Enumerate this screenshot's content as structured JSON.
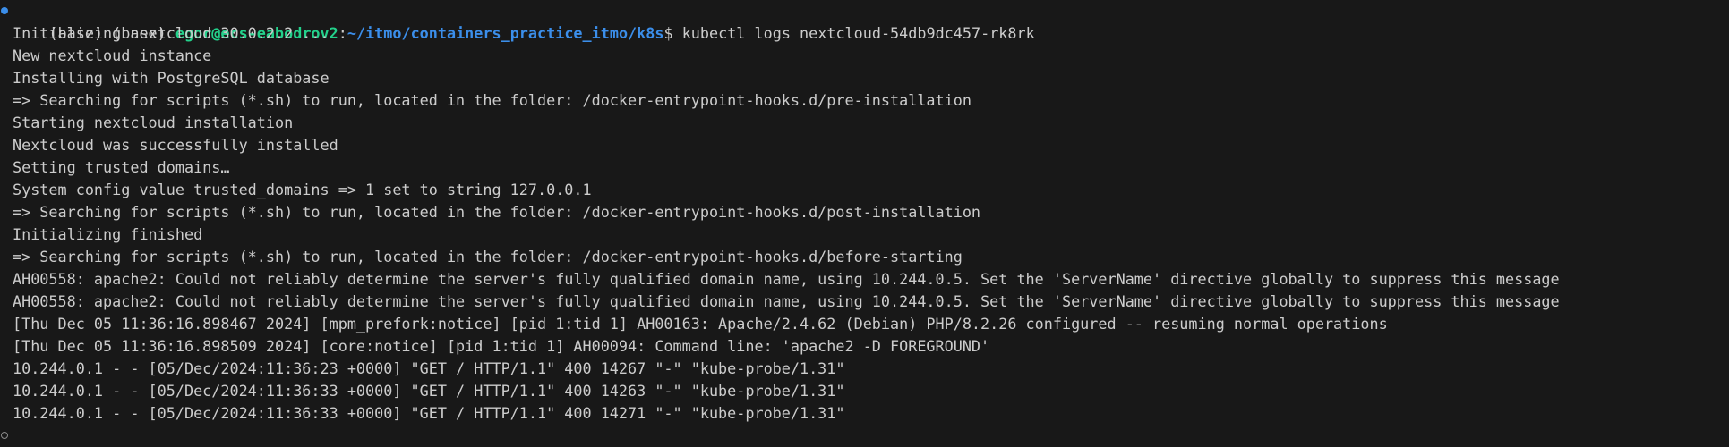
{
  "prompt": {
    "env": "(base) (base) ",
    "user_host": "egor@ecs-eabodrov2",
    "sep": ":",
    "path": "~/itmo/containers_practice_itmo/k8s",
    "symbol": "$ "
  },
  "command": "kubectl logs nextcloud-54db9dc457-rk8rk",
  "output_lines": [
    "Initializing nextcloud 30.0.2.2 ...",
    "New nextcloud instance",
    "Installing with PostgreSQL database",
    "=> Searching for scripts (*.sh) to run, located in the folder: /docker-entrypoint-hooks.d/pre-installation",
    "Starting nextcloud installation",
    "Nextcloud was successfully installed",
    "Setting trusted domains…",
    "System config value trusted_domains => 1 set to string 127.0.0.1",
    "=> Searching for scripts (*.sh) to run, located in the folder: /docker-entrypoint-hooks.d/post-installation",
    "Initializing finished",
    "=> Searching for scripts (*.sh) to run, located in the folder: /docker-entrypoint-hooks.d/before-starting",
    "AH00558: apache2: Could not reliably determine the server's fully qualified domain name, using 10.244.0.5. Set the 'ServerName' directive globally to suppress this message",
    "AH00558: apache2: Could not reliably determine the server's fully qualified domain name, using 10.244.0.5. Set the 'ServerName' directive globally to suppress this message",
    "[Thu Dec 05 11:36:16.898467 2024] [mpm_prefork:notice] [pid 1:tid 1] AH00163: Apache/2.4.62 (Debian) PHP/8.2.26 configured -- resuming normal operations",
    "[Thu Dec 05 11:36:16.898509 2024] [core:notice] [pid 1:tid 1] AH00094: Command line: 'apache2 -D FOREGROUND'",
    "10.244.0.1 - - [05/Dec/2024:11:36:23 +0000] \"GET / HTTP/1.1\" 400 14267 \"-\" \"kube-probe/1.31\"",
    "10.244.0.1 - - [05/Dec/2024:11:36:33 +0000] \"GET / HTTP/1.1\" 400 14263 \"-\" \"kube-probe/1.31\"",
    "10.244.0.1 - - [05/Dec/2024:11:36:33 +0000] \"GET / HTTP/1.1\" 400 14271 \"-\" \"kube-probe/1.31\""
  ],
  "colors": {
    "background": "#181818",
    "text": "#cccccc",
    "user_host": "#23d18b",
    "path": "#3b8eea",
    "command_decoration": "#3b8eea"
  },
  "icons": {
    "command_status": "command-success-dot-icon",
    "prompt_status": "command-pending-circle-icon"
  }
}
